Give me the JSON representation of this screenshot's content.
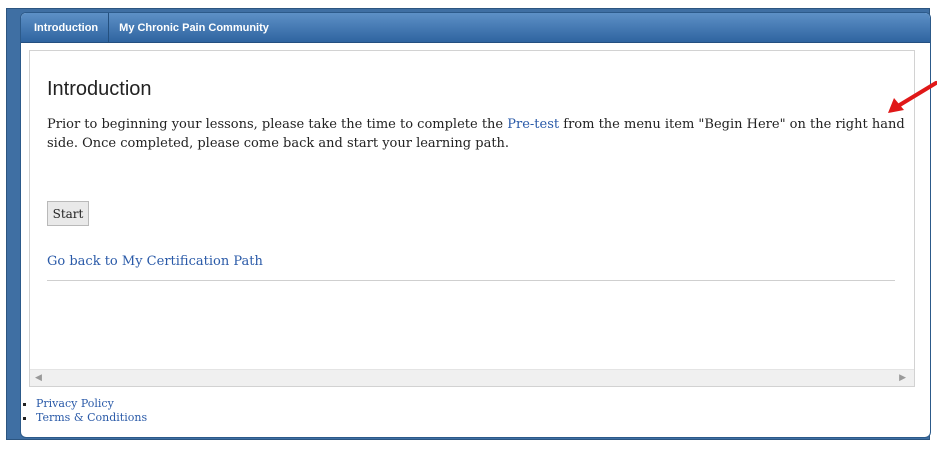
{
  "tabs": [
    {
      "label": "Introduction"
    },
    {
      "label": "My Chronic Pain Community"
    }
  ],
  "page": {
    "title": "Introduction",
    "body_part1": "Prior to beginning your lessons, please take the time to complete the ",
    "pretest_link": "Pre-test",
    "body_part2": " from the menu item \"Begin Here\" on the right hand side. Once completed, please come back and start your learning path.",
    "start_button": "Start",
    "back_link": "Go back to My Certification Path"
  },
  "scrollbar": {
    "left_arrow": "◀",
    "right_arrow": "▶"
  },
  "footer": {
    "links": [
      {
        "label": "Privacy Policy"
      },
      {
        "label": "Terms & Conditions"
      }
    ]
  },
  "colors": {
    "frame_blue": "#3f6fa3",
    "tab_gradient_top": "#5d90c6",
    "tab_gradient_bottom": "#2f64a0",
    "link_blue": "#2a5aa8",
    "annotation_red": "#e01818"
  },
  "icons": {
    "annotation": "red-arrow-icon"
  }
}
